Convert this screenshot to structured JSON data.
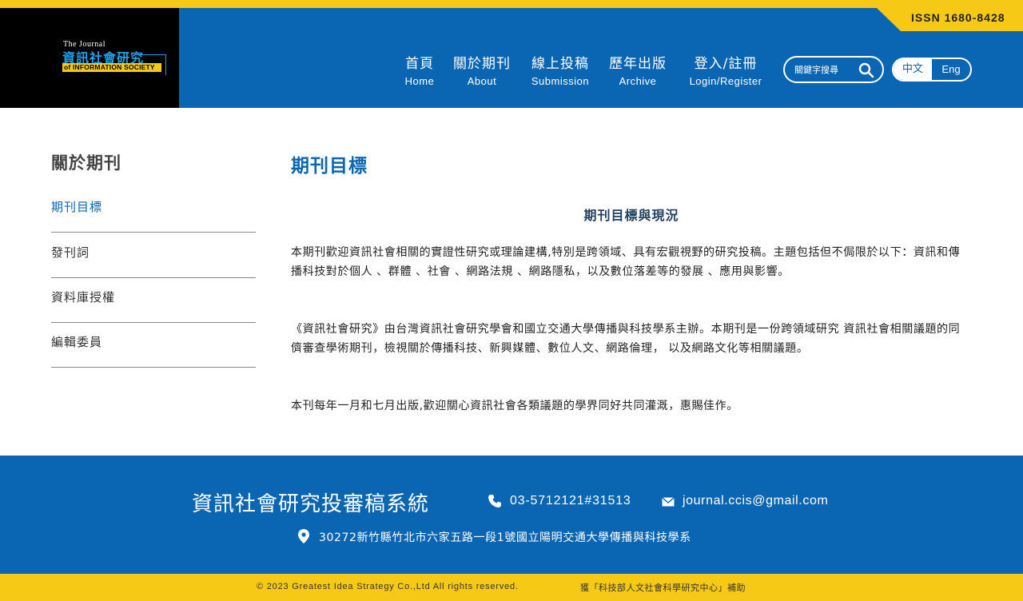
{
  "header": {
    "logo": {
      "line1": "The Journal",
      "line2": "資訊社會研究",
      "line3": "of INFORMATION SOCIETY"
    },
    "issn": "ISSN 1680-8428",
    "nav": [
      {
        "zh": "首頁",
        "en": "Home"
      },
      {
        "zh": "關於期刊",
        "en": "About"
      },
      {
        "zh": "線上投稿",
        "en": "Submission"
      },
      {
        "zh": "歷年出版",
        "en": "Archive"
      },
      {
        "zh": "登入/註冊",
        "en": "Login/Register"
      }
    ],
    "search": {
      "placeholder": "關鍵字搜尋",
      "icon": "search-icon"
    },
    "lang": {
      "zh": "中文",
      "en": "Eng"
    }
  },
  "sidebar": {
    "title": "關於期刊",
    "items": [
      {
        "label": "期刊目標",
        "active": true
      },
      {
        "label": "發刊詞",
        "active": false
      },
      {
        "label": "資料庫授權",
        "active": false
      },
      {
        "label": "編輯委員",
        "active": false
      }
    ]
  },
  "main": {
    "title": "期刊目標",
    "heading": "期刊目標與現況",
    "paragraphs": [
      "本期刊歡迎資訊社會相關的實證性研究或理論建構,特別是跨領域、具有宏觀視野的研究投稿。主題包括但不侷限於以下：資訊和傳播科技對於個人 、群體 、社會 、網路法規 、網路隱私，以及數位落差等的發展 、應用與影響。",
      "《資訊社會研究》由台灣資訊社會研究學會和國立交通大學傳播與科技學系主辦。本期刊是一份跨領域研究 資訊社會相關議題的同儕審查學術期刊，檢視關於傳播科技、新興媒體、數位人文、網路倫理， 以及網路文化等相關議題。",
      "本刊每年一月和七月出版,歡迎關心資訊社會各類議題的學界同好共同灌溉，惠賜佳作。"
    ]
  },
  "footer": {
    "name": "資訊社會研究投審稿系統",
    "phone": "03-5712121#31513",
    "email": "journal.ccis@gmail.com",
    "address": "30272新竹縣竹北市六家五路一段1號國立陽明交通大學傳播與科技學系",
    "copyright": "© 2023 Greatest Idea Strategy Co.,Ltd All rights reserved.",
    "support": "獲「科技部人文社會科學研究中心」補助"
  },
  "colors": {
    "primary": "#0a66b3",
    "accent": "#f7c917",
    "logo_bg": "#000000"
  }
}
